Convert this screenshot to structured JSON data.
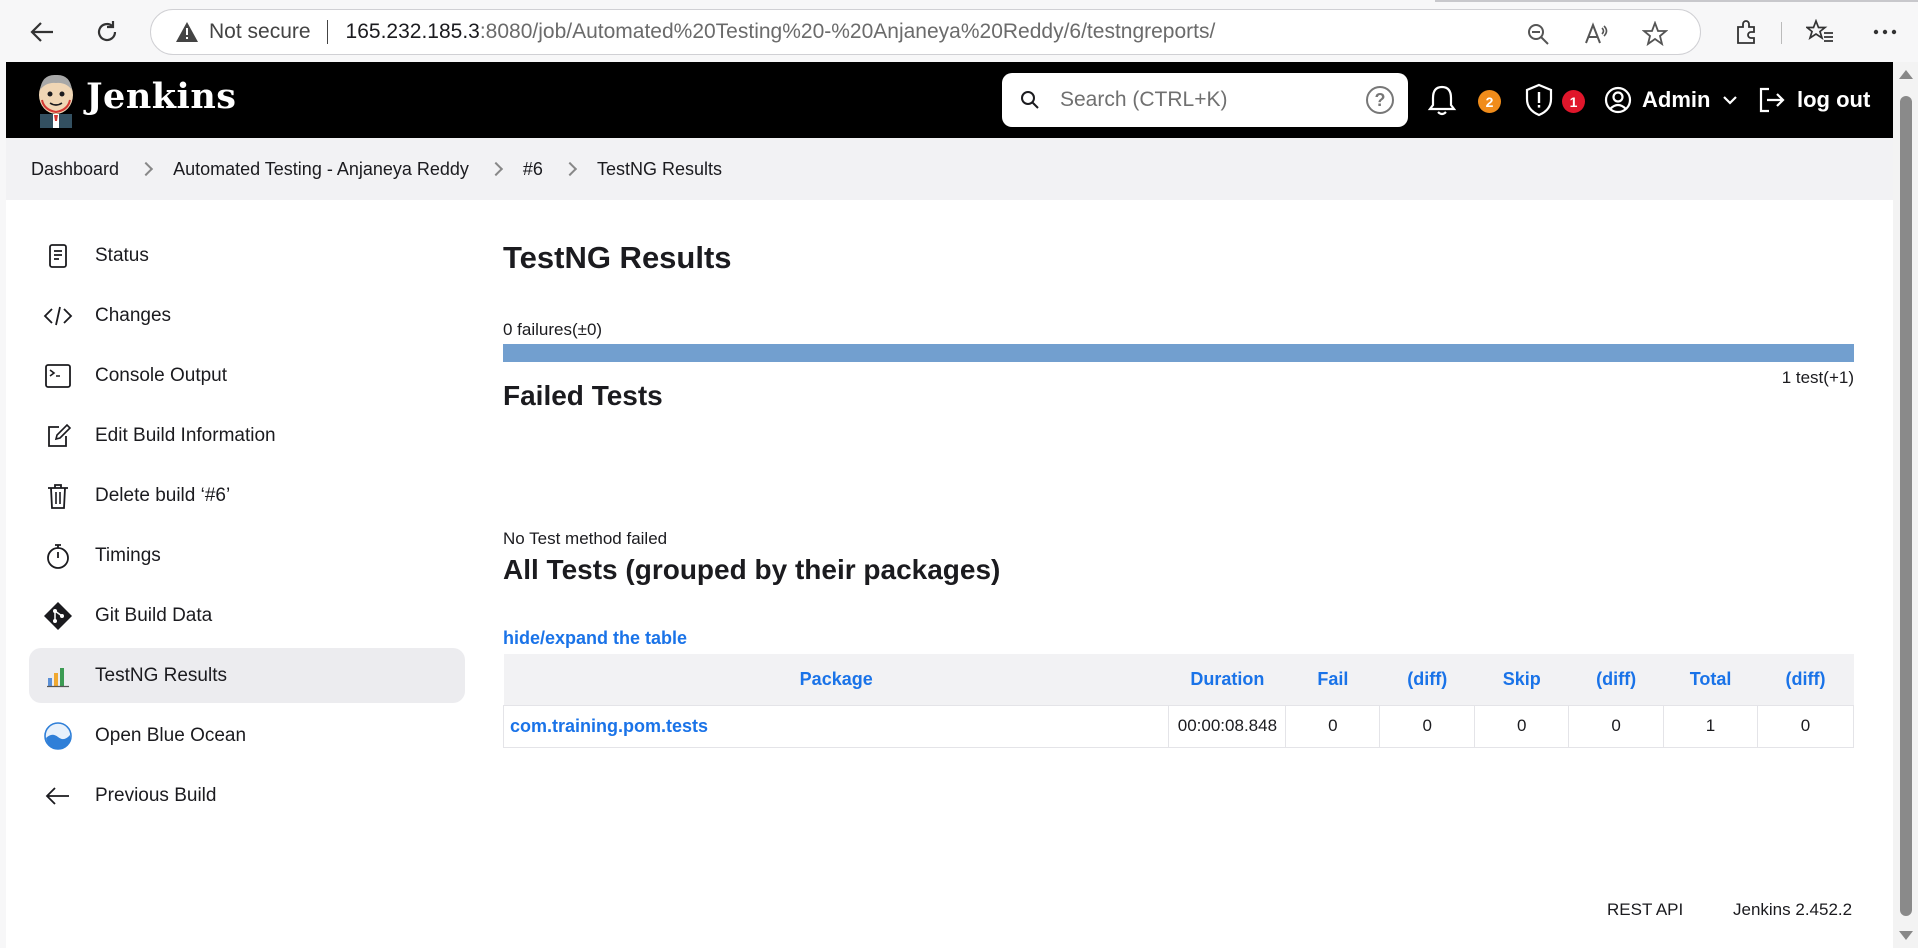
{
  "browser": {
    "security_label": "Not secure",
    "url_host": "165.232.185.3",
    "url_rest": ":8080/job/Automated%20Testing%20-%20Anjaneya%20Reddy/6/testngreports/"
  },
  "header": {
    "brand": "Jenkins",
    "search_placeholder": "Search (CTRL+K)",
    "help_label": "?",
    "notifications_count": "2",
    "security_count": "1",
    "user_label": "Admin",
    "logout_label": "log out",
    "colors": {
      "notifications_badge": "#f08c1a",
      "security_badge": "#e0162b"
    }
  },
  "breadcrumb": [
    "Dashboard",
    "Automated Testing - Anjaneya Reddy",
    "#6",
    "TestNG Results"
  ],
  "sidebar": {
    "items": [
      {
        "label": "Status",
        "icon": "document-icon"
      },
      {
        "label": "Changes",
        "icon": "code-icon"
      },
      {
        "label": "Console Output",
        "icon": "terminal-icon"
      },
      {
        "label": "Edit Build Information",
        "icon": "edit-icon"
      },
      {
        "label": "Delete build ‘#6’",
        "icon": "trash-icon"
      },
      {
        "label": "Timings",
        "icon": "stopwatch-icon"
      },
      {
        "label": "Git Build Data",
        "icon": "git-icon"
      },
      {
        "label": "TestNG Results",
        "icon": "chart-icon",
        "active": true
      },
      {
        "label": "Open Blue Ocean",
        "icon": "blue-ocean-icon"
      },
      {
        "label": "Previous Build",
        "icon": "arrow-left-icon"
      }
    ]
  },
  "main": {
    "title": "TestNG Results",
    "failures_text": "0 failures(±0)",
    "progress_pass_fraction": 1.0,
    "tests_count_text": "1 test(+1)",
    "failed_heading": "Failed Tests",
    "no_failed_text": "No Test method failed",
    "all_tests_heading": "All Tests (grouped by their packages)",
    "toggle_link": "hide/expand the table",
    "table": {
      "headers": [
        "Package",
        "Duration",
        "Fail",
        "(diff)",
        "Skip",
        "(diff)",
        "Total",
        "(diff)"
      ],
      "rows": [
        [
          "com.training.pom.tests",
          "00:00:08.848",
          "0",
          "0",
          "0",
          "0",
          "1",
          "0"
        ]
      ]
    }
  },
  "footer": {
    "rest_api": "REST API",
    "version": "Jenkins 2.452.2"
  }
}
